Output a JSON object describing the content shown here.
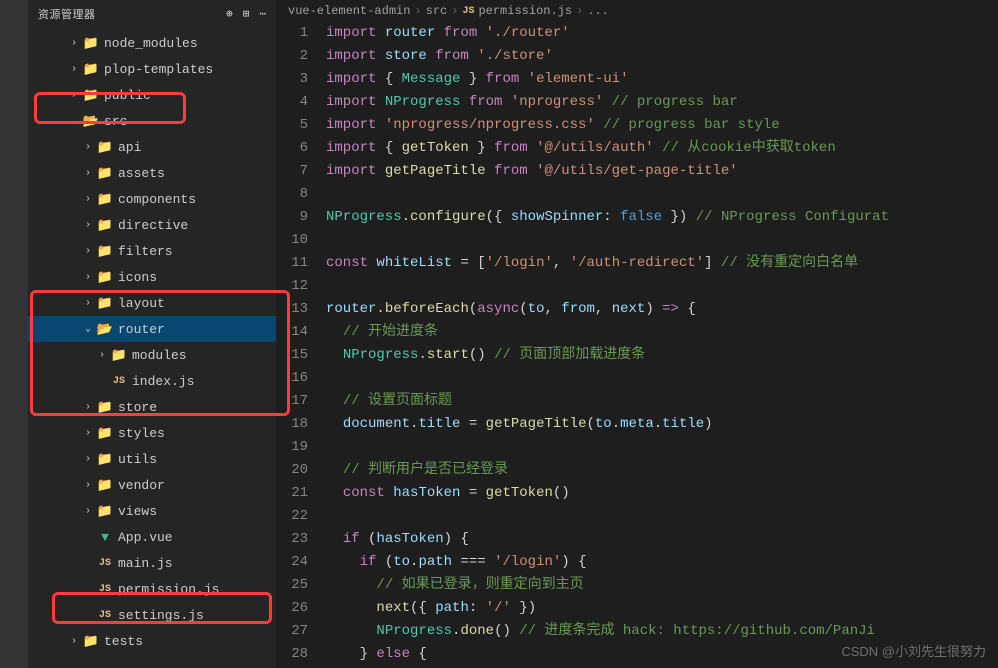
{
  "sidebar": {
    "header_title": "资源管理器",
    "items": [
      {
        "type": "folder",
        "label": "node_modules",
        "depth": 1,
        "chev": ">",
        "iconColor": "green"
      },
      {
        "type": "folder",
        "label": "plop-templates",
        "depth": 1,
        "chev": ">",
        "iconColor": "default"
      },
      {
        "type": "folder",
        "label": "public",
        "depth": 1,
        "chev": ">",
        "iconColor": "green"
      },
      {
        "type": "folder",
        "label": "src",
        "depth": 1,
        "chev": "v",
        "iconColor": "green"
      },
      {
        "type": "folder",
        "label": "api",
        "depth": 2,
        "chev": ">",
        "iconColor": "blue"
      },
      {
        "type": "folder",
        "label": "assets",
        "depth": 2,
        "chev": ">",
        "iconColor": "default"
      },
      {
        "type": "folder",
        "label": "components",
        "depth": 2,
        "chev": ">",
        "iconColor": "default"
      },
      {
        "type": "folder",
        "label": "directive",
        "depth": 2,
        "chev": ">",
        "iconColor": "default"
      },
      {
        "type": "folder",
        "label": "filters",
        "depth": 2,
        "chev": ">",
        "iconColor": "default"
      },
      {
        "type": "folder",
        "label": "icons",
        "depth": 2,
        "chev": ">",
        "iconColor": "default"
      },
      {
        "type": "folder",
        "label": "layout",
        "depth": 2,
        "chev": ">",
        "iconColor": "default"
      },
      {
        "type": "folder",
        "label": "router",
        "depth": 2,
        "chev": "v",
        "iconColor": "default",
        "selected": true
      },
      {
        "type": "folder",
        "label": "modules",
        "depth": 3,
        "chev": ">",
        "iconColor": "blue"
      },
      {
        "type": "file",
        "label": "index.js",
        "depth": 3,
        "fileIcon": "JS"
      },
      {
        "type": "folder",
        "label": "store",
        "depth": 2,
        "chev": ">",
        "iconColor": "default"
      },
      {
        "type": "folder",
        "label": "styles",
        "depth": 2,
        "chev": ">",
        "iconColor": "blue"
      },
      {
        "type": "folder",
        "label": "utils",
        "depth": 2,
        "chev": ">",
        "iconColor": "default"
      },
      {
        "type": "folder",
        "label": "vendor",
        "depth": 2,
        "chev": ">",
        "iconColor": "default"
      },
      {
        "type": "folder",
        "label": "views",
        "depth": 2,
        "chev": ">",
        "iconColor": "default"
      },
      {
        "type": "file",
        "label": "App.vue",
        "depth": 2,
        "fileIcon": "VUE"
      },
      {
        "type": "file",
        "label": "main.js",
        "depth": 2,
        "fileIcon": "JS"
      },
      {
        "type": "file",
        "label": "permission.js",
        "depth": 2,
        "fileIcon": "JS"
      },
      {
        "type": "file",
        "label": "settings.js",
        "depth": 2,
        "fileIcon": "JS"
      },
      {
        "type": "folder",
        "label": "tests",
        "depth": 1,
        "chev": ">",
        "iconColor": "default"
      }
    ]
  },
  "breadcrumb": {
    "parts": [
      "vue-element-admin",
      "src",
      "permission.js",
      "..."
    ],
    "js_label": "JS"
  },
  "code": {
    "lines": [
      [
        [
          "kw",
          "import "
        ],
        [
          "var",
          "router"
        ],
        [
          "kw",
          " from "
        ],
        [
          "str",
          "'./router'"
        ]
      ],
      [
        [
          "kw",
          "import "
        ],
        [
          "var",
          "store"
        ],
        [
          "kw",
          " from "
        ],
        [
          "str",
          "'./store'"
        ]
      ],
      [
        [
          "kw",
          "import "
        ],
        [
          "p",
          "{ "
        ],
        [
          "name",
          "Message"
        ],
        [
          "p",
          " } "
        ],
        [
          "kw",
          "from "
        ],
        [
          "str",
          "'element-ui'"
        ]
      ],
      [
        [
          "kw",
          "import "
        ],
        [
          "name",
          "NProgress"
        ],
        [
          "kw",
          " from "
        ],
        [
          "str",
          "'nprogress'"
        ],
        [
          "cm",
          " // progress bar"
        ]
      ],
      [
        [
          "kw",
          "import "
        ],
        [
          "str",
          "'nprogress/nprogress.css'"
        ],
        [
          "cm",
          " // progress bar style"
        ]
      ],
      [
        [
          "kw",
          "import "
        ],
        [
          "p",
          "{ "
        ],
        [
          "fn",
          "getToken"
        ],
        [
          "p",
          " } "
        ],
        [
          "kw",
          "from "
        ],
        [
          "str",
          "'@/utils/auth'"
        ],
        [
          "cm",
          " // 从cookie中获取token"
        ]
      ],
      [
        [
          "kw",
          "import "
        ],
        [
          "fn",
          "getPageTitle"
        ],
        [
          "kw",
          " from "
        ],
        [
          "str",
          "'@/utils/get-page-title'"
        ]
      ],
      [],
      [
        [
          "name",
          "NProgress"
        ],
        [
          "p",
          "."
        ],
        [
          "fn",
          "configure"
        ],
        [
          "p",
          "({ "
        ],
        [
          "var",
          "showSpinner"
        ],
        [
          "p",
          ": "
        ],
        [
          "const",
          "false"
        ],
        [
          "p",
          " }) "
        ],
        [
          "cm",
          "// NProgress Configurat"
        ]
      ],
      [],
      [
        [
          "kw",
          "const "
        ],
        [
          "var",
          "whiteList"
        ],
        [
          "p",
          " = ["
        ],
        [
          "str",
          "'/login'"
        ],
        [
          "p",
          ", "
        ],
        [
          "str",
          "'/auth-redirect'"
        ],
        [
          "p",
          "] "
        ],
        [
          "cm",
          "// 没有重定向白名单"
        ]
      ],
      [],
      [
        [
          "var",
          "router"
        ],
        [
          "p",
          "."
        ],
        [
          "fn",
          "beforeEach"
        ],
        [
          "p",
          "("
        ],
        [
          "kw",
          "async"
        ],
        [
          "p",
          "("
        ],
        [
          "param",
          "to"
        ],
        [
          "p",
          ", "
        ],
        [
          "param",
          "from"
        ],
        [
          "p",
          ", "
        ],
        [
          "param",
          "next"
        ],
        [
          "p",
          ") "
        ],
        [
          "kw",
          "=>"
        ],
        [
          "p",
          " {"
        ]
      ],
      [
        [
          "p",
          "  "
        ],
        [
          "cm",
          "// 开始进度条"
        ]
      ],
      [
        [
          "p",
          "  "
        ],
        [
          "name",
          "NProgress"
        ],
        [
          "p",
          "."
        ],
        [
          "fn",
          "start"
        ],
        [
          "p",
          "() "
        ],
        [
          "cm",
          "// 页面顶部加载进度条"
        ]
      ],
      [],
      [
        [
          "p",
          "  "
        ],
        [
          "cm",
          "// 设置页面标题"
        ]
      ],
      [
        [
          "p",
          "  "
        ],
        [
          "var",
          "document"
        ],
        [
          "p",
          "."
        ],
        [
          "var",
          "title"
        ],
        [
          "p",
          " = "
        ],
        [
          "fn",
          "getPageTitle"
        ],
        [
          "p",
          "("
        ],
        [
          "var",
          "to"
        ],
        [
          "p",
          "."
        ],
        [
          "var",
          "meta"
        ],
        [
          "p",
          "."
        ],
        [
          "var",
          "title"
        ],
        [
          "p",
          ")"
        ]
      ],
      [],
      [
        [
          "p",
          "  "
        ],
        [
          "cm",
          "// 判断用户是否已经登录"
        ]
      ],
      [
        [
          "p",
          "  "
        ],
        [
          "kw",
          "const "
        ],
        [
          "var",
          "hasToken"
        ],
        [
          "p",
          " = "
        ],
        [
          "fn",
          "getToken"
        ],
        [
          "p",
          "()"
        ]
      ],
      [],
      [
        [
          "p",
          "  "
        ],
        [
          "kw",
          "if"
        ],
        [
          "p",
          " ("
        ],
        [
          "var",
          "hasToken"
        ],
        [
          "p",
          ") {"
        ]
      ],
      [
        [
          "p",
          "    "
        ],
        [
          "kw",
          "if"
        ],
        [
          "p",
          " ("
        ],
        [
          "var",
          "to"
        ],
        [
          "p",
          "."
        ],
        [
          "var",
          "path"
        ],
        [
          "p",
          " === "
        ],
        [
          "str",
          "'/login'"
        ],
        [
          "p",
          ") {"
        ]
      ],
      [
        [
          "p",
          "      "
        ],
        [
          "cm",
          "// 如果已登录，则重定向到主页"
        ]
      ],
      [
        [
          "p",
          "      "
        ],
        [
          "fn",
          "next"
        ],
        [
          "p",
          "({ "
        ],
        [
          "var",
          "path"
        ],
        [
          "p",
          ": "
        ],
        [
          "str",
          "'/'"
        ],
        [
          "p",
          " })"
        ]
      ],
      [
        [
          "p",
          "      "
        ],
        [
          "name",
          "NProgress"
        ],
        [
          "p",
          "."
        ],
        [
          "fn",
          "done"
        ],
        [
          "p",
          "() "
        ],
        [
          "cm",
          "// 进度条完成 hack: https://github.com/PanJi"
        ]
      ],
      [
        [
          "p",
          "    } "
        ],
        [
          "kw",
          "else"
        ],
        [
          "p",
          " {"
        ]
      ]
    ]
  },
  "watermark": "CSDN @小刘先生很努力"
}
